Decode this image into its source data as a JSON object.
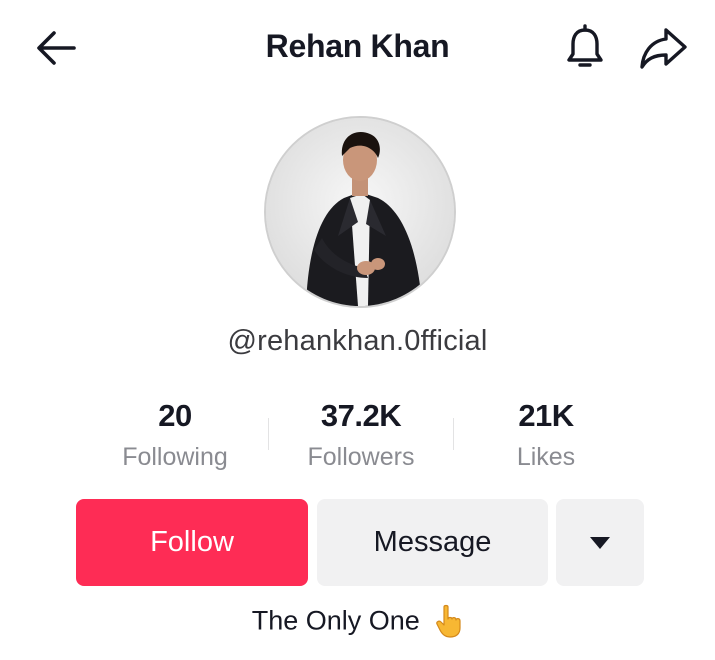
{
  "header": {
    "title": "Rehan Khan",
    "back_icon": "arrow-left-icon",
    "bell_icon": "bell-icon",
    "share_icon": "share-arrow-icon"
  },
  "profile": {
    "username": "@rehankhan.0fficial",
    "avatar": "profile-photo"
  },
  "stats": [
    {
      "value": "20",
      "label": "Following"
    },
    {
      "value": "37.2K",
      "label": "Followers"
    },
    {
      "value": "21K",
      "label": "Likes"
    }
  ],
  "actions": {
    "follow_label": "Follow",
    "message_label": "Message",
    "more_icon": "caret-down-icon"
  },
  "bio": {
    "text": "The Only One",
    "emoji_icon": "pointing-up-hand-icon"
  },
  "colors": {
    "accent": "#fe2c55",
    "text": "#161823",
    "secondary_text": "#8a8b91",
    "button_gray": "#f1f1f2"
  }
}
